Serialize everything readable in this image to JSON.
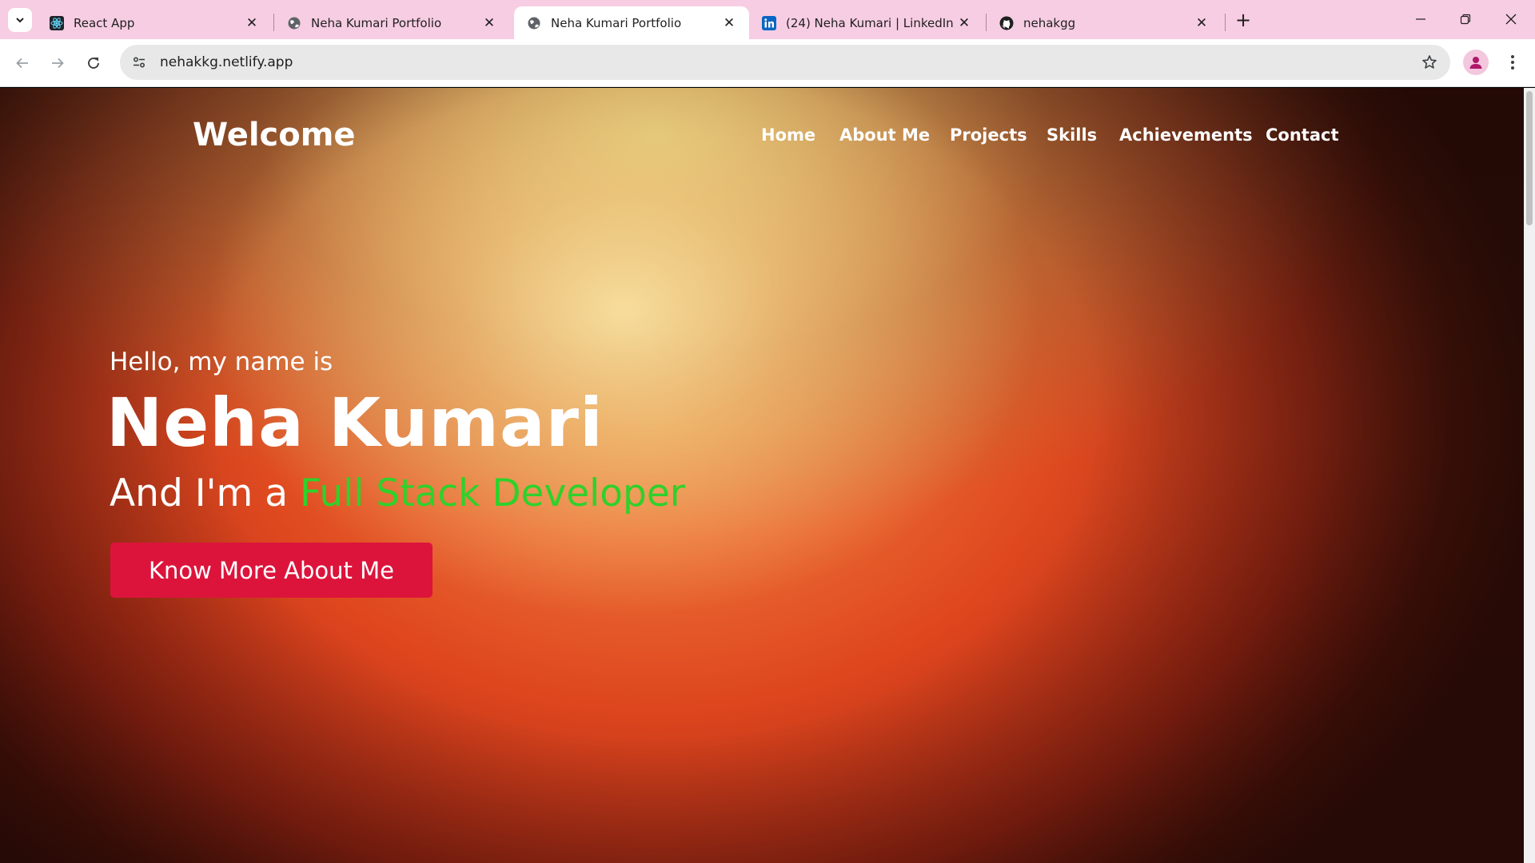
{
  "browser": {
    "tabs": [
      {
        "title": "React App",
        "icon": "react-icon",
        "active": false
      },
      {
        "title": "Neha Kumari Portfolio",
        "icon": "globe-icon",
        "active": false
      },
      {
        "title": "Neha Kumari Portfolio",
        "icon": "globe-icon",
        "active": true
      },
      {
        "title": "(24) Neha Kumari | LinkedIn",
        "icon": "linkedin-icon",
        "active": false
      },
      {
        "title": "nehakgg",
        "icon": "github-icon",
        "active": false
      }
    ],
    "url": "nehakkg.netlify.app",
    "colors": {
      "tabstrip": "#f7cde3",
      "toolbar": "#ffffff",
      "omnibox": "#e8e8e8"
    }
  },
  "page": {
    "brand": "Welcome",
    "nav": [
      "Home",
      "About Me",
      "Projects",
      "Skills",
      "Achievements",
      "Contact"
    ],
    "hero": {
      "greeting": "Hello, my name is",
      "name": "Neha Kumari",
      "role_prefix": "And I'm a ",
      "role_highlight": "Full Stack Developer",
      "cta_label": "Know More About Me"
    },
    "colors": {
      "accent_green": "#2fd12a",
      "cta": "#dc143c",
      "text": "#ffffff"
    }
  }
}
